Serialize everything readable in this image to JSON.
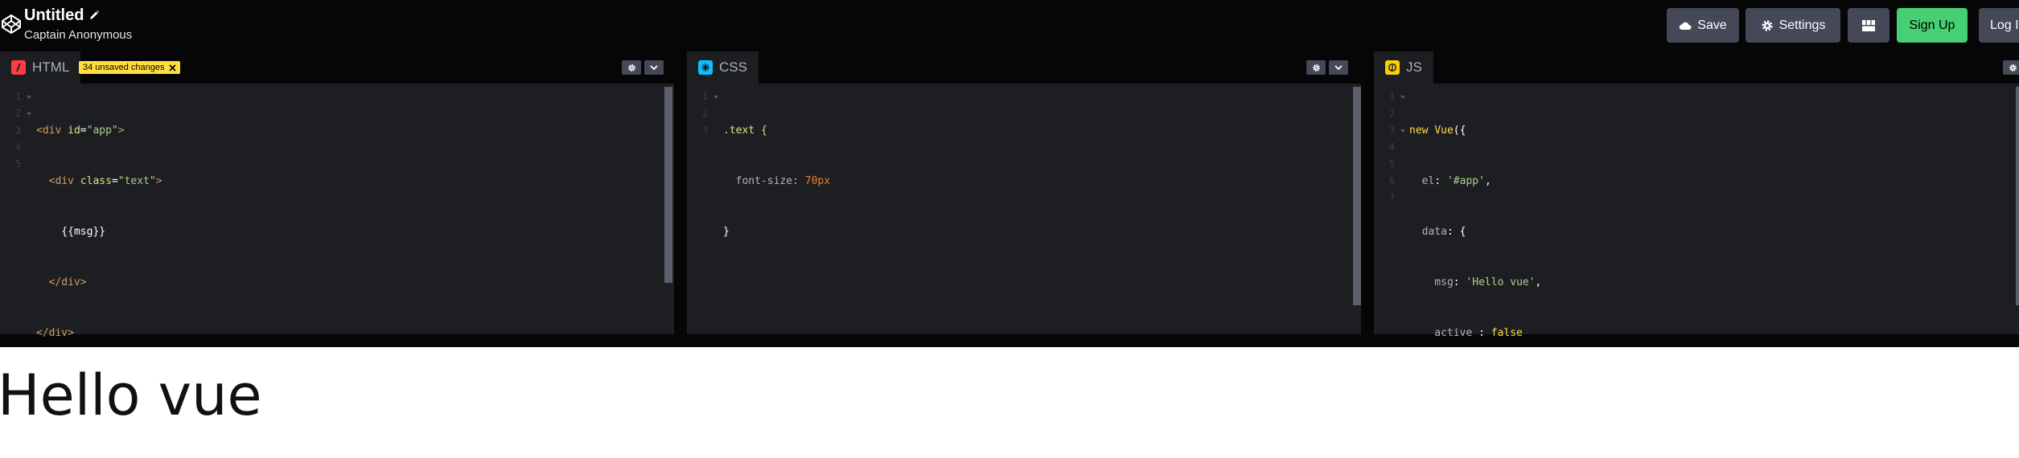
{
  "header": {
    "title": "Untitled",
    "author": "Captain Anonymous",
    "buttons": {
      "save": "Save",
      "settings": "Settings",
      "signup": "Sign Up",
      "login": "Log In"
    }
  },
  "editors": {
    "html": {
      "label": "HTML",
      "unsaved": "34 unsaved changes",
      "line_numbers": [
        "1",
        "2",
        "3",
        "4",
        "5"
      ]
    },
    "css": {
      "label": "CSS",
      "line_numbers": [
        "1",
        "2",
        "3"
      ]
    },
    "js": {
      "label": "JS",
      "line_numbers": [
        "1",
        "2",
        "3",
        "4",
        "5",
        "6",
        "7"
      ]
    }
  },
  "code": {
    "html": {
      "l1a": "<div ",
      "l1b": "id",
      "l1c": "=",
      "l1d": "\"app\"",
      "l1e": ">",
      "l2a": "  <div ",
      "l2b": "class",
      "l2c": "=",
      "l2d": "\"text\"",
      "l2e": ">",
      "l3": "    {{msg}}",
      "l4": "  </div>",
      "l5": "</div>"
    },
    "css": {
      "l1": ".text {",
      "l2a": "  font-size: ",
      "l2b": "70px",
      "l3": "}"
    },
    "js": {
      "l1a": "new ",
      "l1b": "Vue",
      "l1c": "({",
      "l2a": "  el",
      "l2b": ": ",
      "l2c": "'#app'",
      "l2d": ",",
      "l3a": "  data",
      "l3b": ": {",
      "l4a": "    msg",
      "l4b": ": ",
      "l4c": "'Hello vue'",
      "l4d": ",",
      "l5a": "    active ",
      "l5b": ": ",
      "l5c": "false",
      "l6": "  }",
      "l7": "})"
    }
  },
  "preview": {
    "text": "Hello vue"
  },
  "colors": {
    "header_bg": "#060606",
    "button_bg": "#444857",
    "signup_bg": "#47cf73",
    "editor_bg": "#1d1e22",
    "html_icon": "#ff3c41",
    "css_icon": "#0ebeff",
    "js_icon": "#fcd000",
    "unsaved_badge": "#ffdd40"
  },
  "icons": [
    "codepen-logo-icon",
    "pencil-icon",
    "cloud-icon",
    "gear-icon",
    "layout-grid-icon",
    "chevron-down-icon",
    "html-icon",
    "css-icon",
    "js-icon",
    "close-icon"
  ]
}
